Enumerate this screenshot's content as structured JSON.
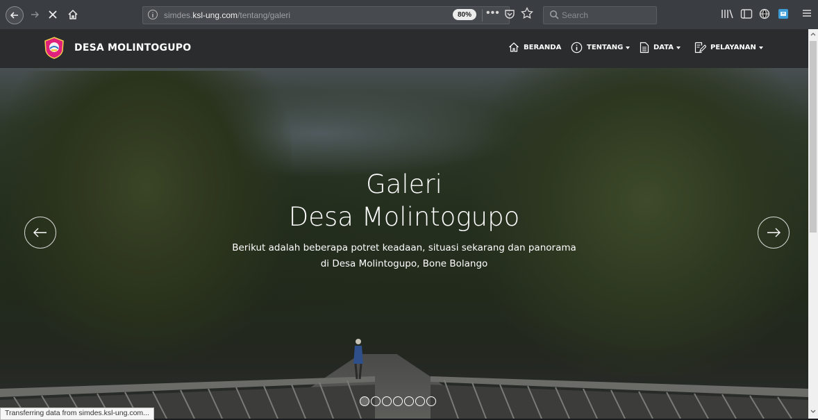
{
  "browser": {
    "url_prefix": "simdes.",
    "url_domain": "ksl-ung.com",
    "url_path": "/tentang/galeri",
    "zoom": "80%",
    "search_placeholder": "Search",
    "more_label": "•••"
  },
  "site": {
    "brand": "DESA MOLINTOGUPO",
    "menu": [
      {
        "label": "BERANDA",
        "icon": "home-icon"
      },
      {
        "label": "TENTANG",
        "icon": "info-icon"
      },
      {
        "label": "DATA",
        "icon": "document-icon"
      },
      {
        "label": "PELAYANAN",
        "icon": "edit-icon"
      }
    ]
  },
  "hero": {
    "title_line1": "Galeri",
    "title_line2": "Desa Molintogupo",
    "subtitle_line1": "Berikut adalah beberapa potret keadaan, situasi sekarang dan panorama",
    "subtitle_line2": "di Desa Molintogupo, Bone Bolango",
    "slides_count": 7,
    "active_slide": 1
  },
  "status_text": "Transferring data from simdes.ksl-ung.com..."
}
